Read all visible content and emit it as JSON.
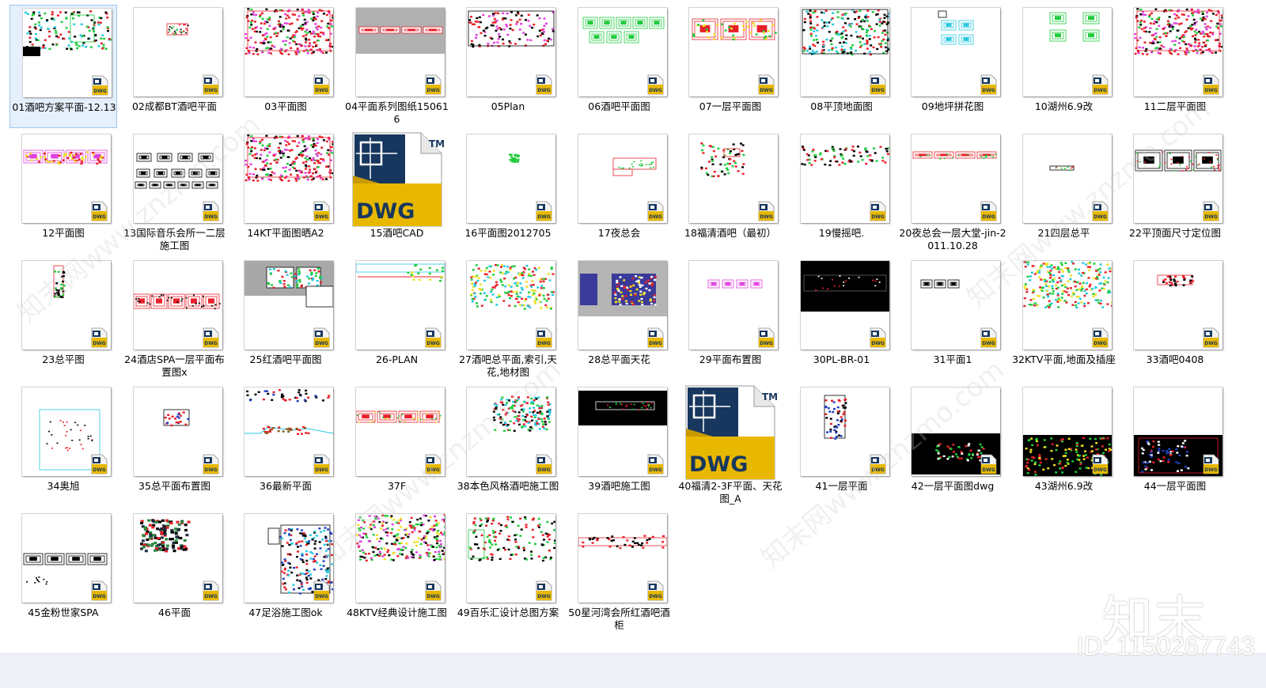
{
  "files": [
    {
      "label": "01酒吧方案平面-12.13",
      "thumb": "plan-green",
      "selected": true
    },
    {
      "label": "02成都BT酒吧平面",
      "thumb": "tiny-red"
    },
    {
      "label": "03平面图",
      "thumb": "red-dense"
    },
    {
      "label": "04平面系列图纸150616",
      "thumb": "gray-strip"
    },
    {
      "label": "05Plan",
      "thumb": "red-grid"
    },
    {
      "label": "06酒吧平面图",
      "thumb": "green-panels"
    },
    {
      "label": "07一层平面图",
      "thumb": "yellow-panels"
    },
    {
      "label": "08平顶地面图",
      "thumb": "green-plan"
    },
    {
      "label": "09地坪拼花图",
      "thumb": "cyan-blocks"
    },
    {
      "label": "10湖州6.9改",
      "thumb": "green-small"
    },
    {
      "label": "11二层平面图",
      "thumb": "red-dense"
    },
    {
      "label": "12平面图",
      "thumb": "pink-strip"
    },
    {
      "label": "13国际音乐会所一二层施工图",
      "thumb": "bw-grid"
    },
    {
      "label": "14KT平面图晒A2",
      "thumb": "red-dense"
    },
    {
      "label": "15酒吧CAD",
      "thumb": "dwg-icon"
    },
    {
      "label": "16平面图2012705",
      "thumb": "tiny-green"
    },
    {
      "label": "17夜总会",
      "thumb": "red-box"
    },
    {
      "label": "18福清酒吧（最初）",
      "thumb": "green-tree"
    },
    {
      "label": "19慢摇吧.",
      "thumb": "green-strip"
    },
    {
      "label": "20夜总会一层大堂-jin-2011.10.28",
      "thumb": "red-strip"
    },
    {
      "label": "21四层总平",
      "thumb": "tiny-line"
    },
    {
      "label": "22平顶面尺寸定位图",
      "thumb": "gray-panels"
    },
    {
      "label": "23总平图",
      "thumb": "vertical-strip"
    },
    {
      "label": "24酒店SPA一层平面布置图x",
      "thumb": "red-panels"
    },
    {
      "label": "25红酒吧平面图",
      "thumb": "gray-green"
    },
    {
      "label": "26-PLAN",
      "thumb": "line-plan"
    },
    {
      "label": "27酒吧总平面,索引,天花,地材图",
      "thumb": "red-green-dense"
    },
    {
      "label": "28总平面天花",
      "thumb": "gray-red"
    },
    {
      "label": "29平面布置图",
      "thumb": "magenta-panels"
    },
    {
      "label": "30PL-BR-01",
      "thumb": "black-plan"
    },
    {
      "label": "31平面1",
      "thumb": "small-panels"
    },
    {
      "label": "32KTV平面,地面及插座",
      "thumb": "cyan-dense"
    },
    {
      "label": "33酒吧0408",
      "thumb": "red-small"
    },
    {
      "label": "34奥旭",
      "thumb": "cyan-frame"
    },
    {
      "label": "35总平面布置图",
      "thumb": "red-tiny-box"
    },
    {
      "label": "36最新平面",
      "thumb": "section"
    },
    {
      "label": "37F",
      "thumb": "yellow-strip"
    },
    {
      "label": "38本色风格酒吧施工图",
      "thumb": "red-scatter"
    },
    {
      "label": "39酒吧施工图",
      "thumb": "black-strip"
    },
    {
      "label": "40福清2-3F平面、天花图_A",
      "thumb": "dwg-icon"
    },
    {
      "label": "41一层平面",
      "thumb": "vertical-blue"
    },
    {
      "label": "42一层平面图dwg",
      "thumb": "black-wide"
    },
    {
      "label": "43湖州6.9改",
      "thumb": "black-green"
    },
    {
      "label": "44一层平面图",
      "thumb": "black-red"
    },
    {
      "label": "45金粉世家SPA",
      "thumb": "bw-panels"
    },
    {
      "label": "46平面",
      "thumb": "dark-blocks"
    },
    {
      "label": "47足浴施工图ok",
      "thumb": "blue-tall"
    },
    {
      "label": "48KTV经典设计施工图",
      "thumb": "yellow-dense"
    },
    {
      "label": "49百乐汇设计总图方案",
      "thumb": "green-list"
    },
    {
      "label": "50星河湾会所红酒吧酒柜",
      "thumb": "red-line"
    }
  ],
  "icon": {
    "badge_text": "DWG",
    "big_icon_text": "DWG",
    "big_icon_tm": "TM"
  },
  "watermark": {
    "logo": "知末",
    "id": "ID: 1150267743",
    "diag": "知末网www.znzmo.com"
  },
  "colors": {
    "selection_bg": "#e6f0fc",
    "selection_border": "#99c6f0",
    "cad_red": "#e8202a",
    "cad_green": "#1fcc3c",
    "cad_cyan": "#25c8e0",
    "cad_yellow": "#f0e020",
    "cad_magenta": "#e040e0",
    "dwg_blue": "#17375e",
    "dwg_gold": "#e8b800"
  }
}
